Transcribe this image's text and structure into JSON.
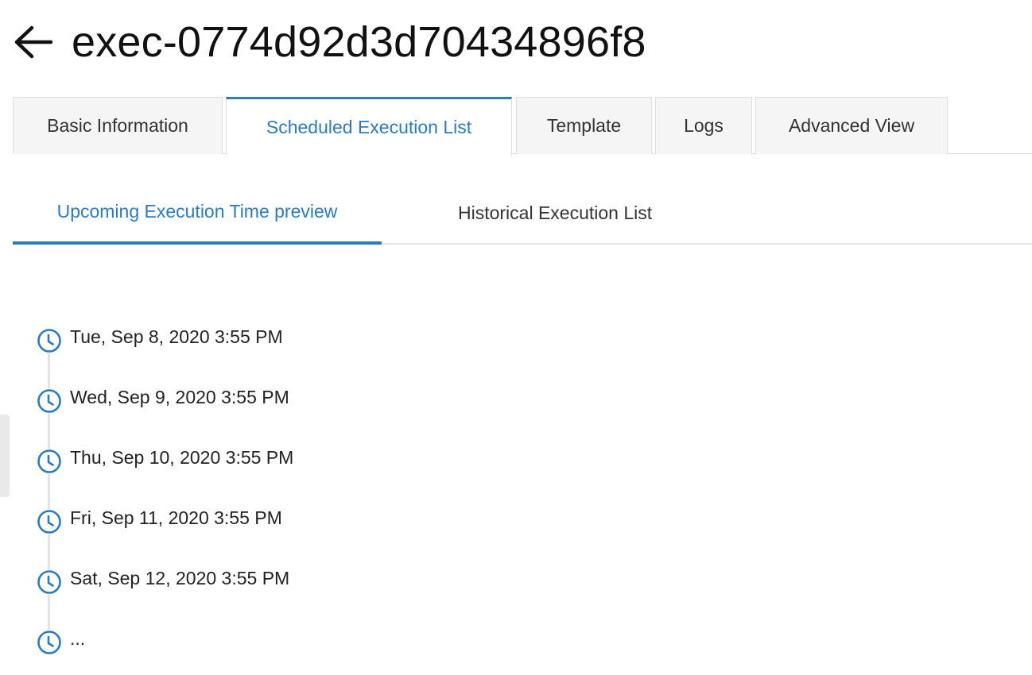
{
  "header": {
    "title": "exec-0774d92d3d70434896f8",
    "back_icon": "arrow-left-icon"
  },
  "main_tabs": [
    {
      "label": "Basic Information",
      "active": false
    },
    {
      "label": "Scheduled Execution List",
      "active": true
    },
    {
      "label": "Template",
      "active": false
    },
    {
      "label": "Logs",
      "active": false
    },
    {
      "label": "Advanced View",
      "active": false
    }
  ],
  "sub_tabs": [
    {
      "label": "Upcoming Execution Time preview",
      "active": true
    },
    {
      "label": "Historical Execution List",
      "active": false
    }
  ],
  "timeline": {
    "icon": "clock-icon",
    "items": [
      "Tue, Sep 8, 2020 3:55 PM",
      "Wed, Sep 9, 2020 3:55 PM",
      "Thu, Sep 10, 2020 3:55 PM",
      "Fri, Sep 11, 2020 3:55 PM",
      "Sat, Sep 12, 2020 3:55 PM",
      "..."
    ]
  },
  "colors": {
    "accent": "#2b7bc4",
    "tab_bg": "#f5f5f5",
    "border": "#dddddd",
    "timeline_line": "#e3e3e3"
  }
}
